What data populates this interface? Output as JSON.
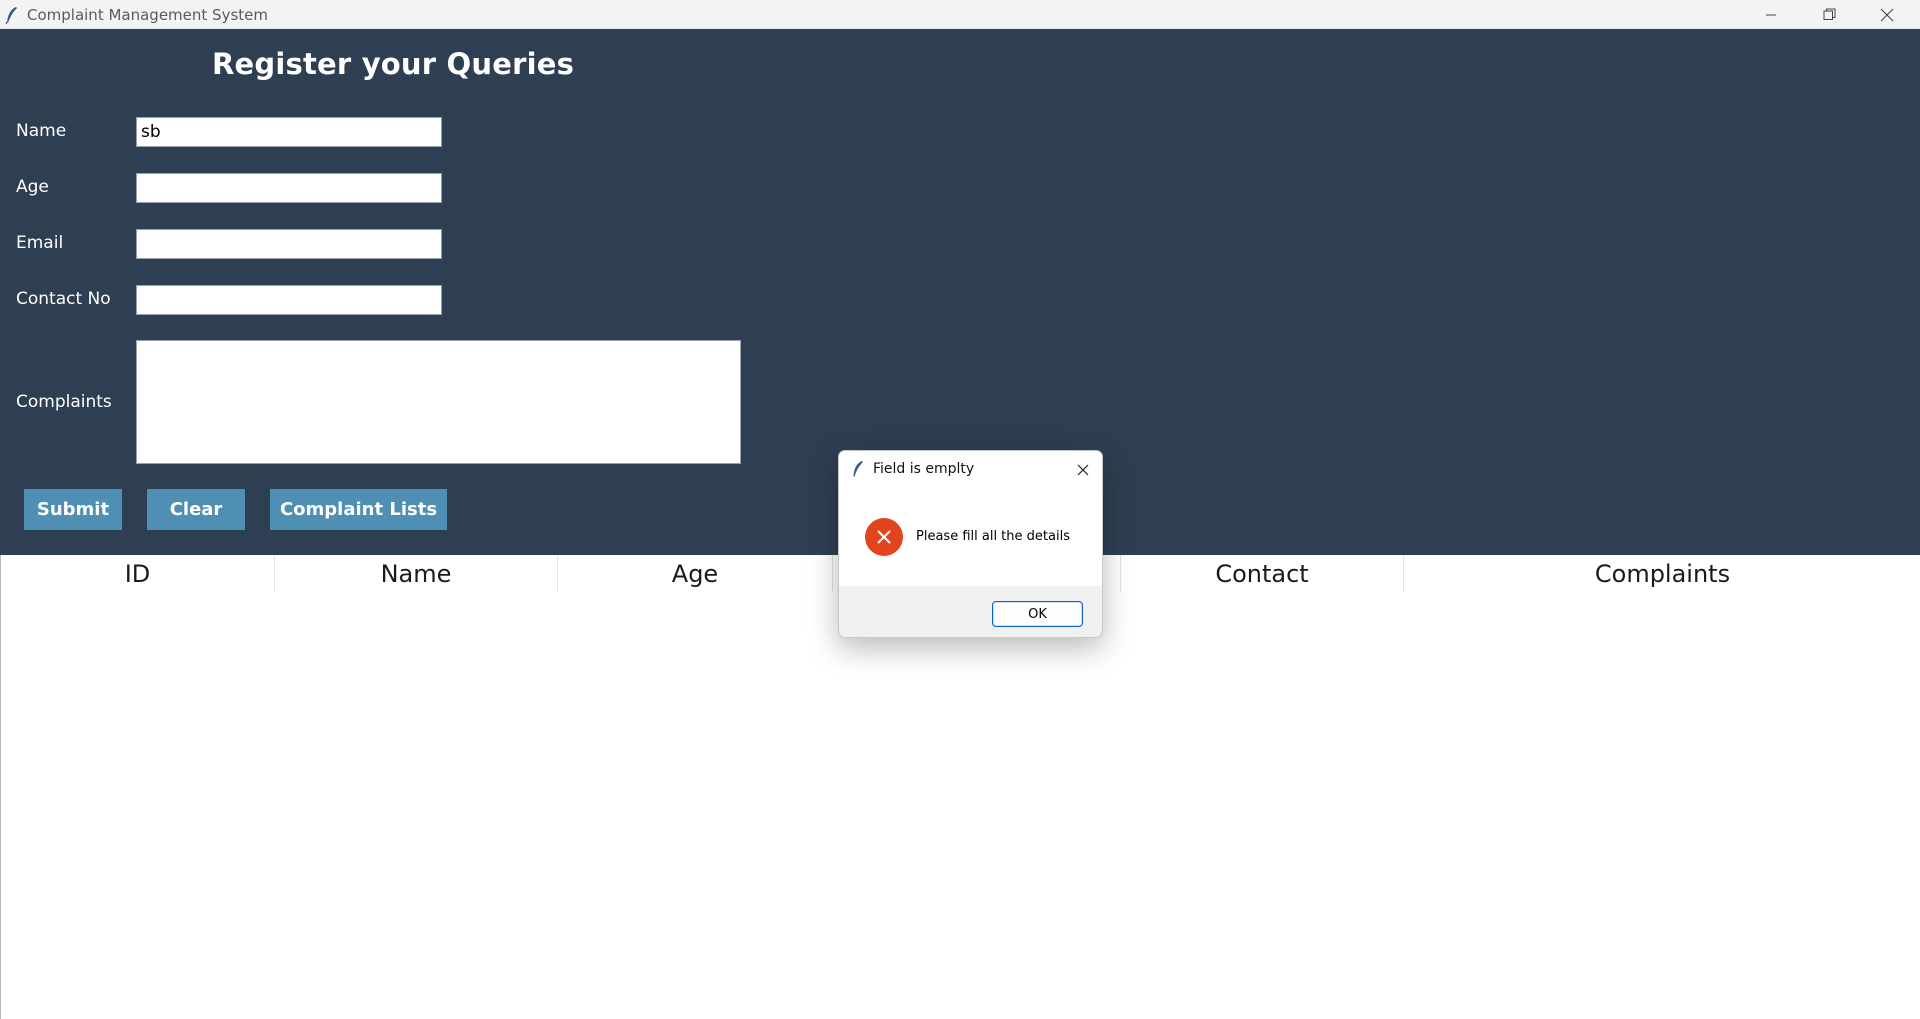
{
  "window": {
    "title": "Complaint Management System",
    "icon": "feather-icon",
    "controls": [
      "minimize-icon",
      "restore-icon",
      "close-icon"
    ]
  },
  "form": {
    "title": "Register your Queries",
    "fields": {
      "name": {
        "label": "Name",
        "value": "sb"
      },
      "age": {
        "label": "Age",
        "value": ""
      },
      "email": {
        "label": "Email",
        "value": ""
      },
      "contact": {
        "label": "Contact No",
        "value": ""
      },
      "complaints": {
        "label": "Complaints",
        "value": ""
      }
    },
    "buttons": {
      "submit": "Submit",
      "clear": "Clear",
      "complaint_lists": "Complaint Lists"
    },
    "colors": {
      "panel_bg": "#2e3f53",
      "button_bg": "#4f8fb3"
    }
  },
  "table": {
    "columns": [
      "ID",
      "Name",
      "Age",
      "",
      "Contact",
      "Complaints"
    ],
    "rows": []
  },
  "dialog": {
    "title": "Field is emplty",
    "message": "Please fill all the details",
    "ok_label": "OK",
    "icon": "error-icon",
    "icon_color": "#e2441d"
  }
}
